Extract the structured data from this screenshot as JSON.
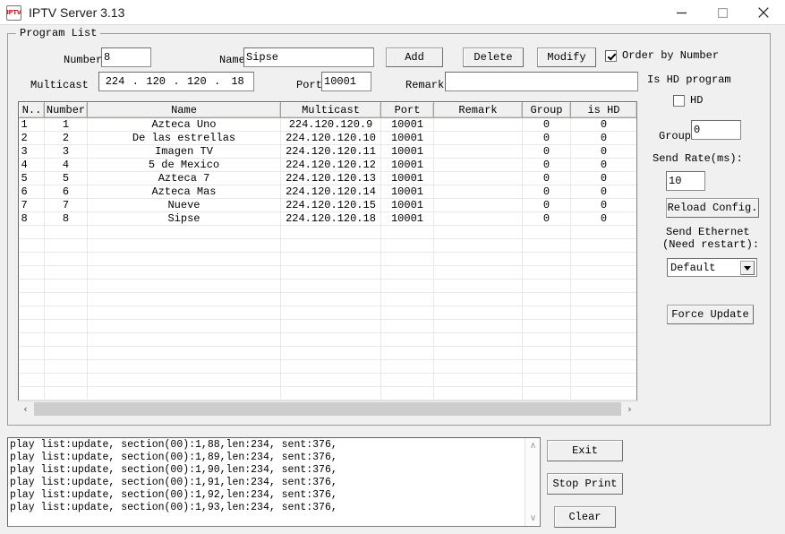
{
  "window": {
    "title": "IPTV Server 3.13",
    "icon": "iptv-app-icon",
    "icon_text": "IPTV",
    "minimize": "—",
    "maximize": "□",
    "close": "✕"
  },
  "group": {
    "title": "Program List"
  },
  "form": {
    "number_label": "Number",
    "number_value": "8",
    "name_label": "Name",
    "name_value": "Sipse",
    "multicast_label": "Multicast",
    "multicast_octets": [
      "224",
      "120",
      "120",
      "18"
    ],
    "multicast_sep": ".",
    "port_label": "Port",
    "port_value": "10001",
    "remark_label": "Remark",
    "remark_value": "",
    "add_label": "Add",
    "delete_label": "Delete",
    "modify_label": "Modify",
    "order_by_number_label": "Order by Number",
    "order_by_number_checked": true
  },
  "side": {
    "is_hd_program_label": "Is HD program",
    "hd_label": "HD",
    "hd_checked": false,
    "group_label": "Group",
    "group_value": "0",
    "send_rate_label": "Send Rate(ms):",
    "send_rate_value": "10",
    "reload_config_label": "Reload Config.",
    "send_ethernet_label_line1": "Send Ethernet",
    "send_ethernet_label_line2": "(Need restart):",
    "ethernet_selected": "Default",
    "ethernet_options": [
      "Default"
    ],
    "force_update_label": "Force Update"
  },
  "table": {
    "columns": [
      "N..",
      "Number",
      "Name",
      "Multicast",
      "Port",
      "Remark",
      "Group",
      "is HD"
    ],
    "rows": [
      [
        "1",
        "1",
        "Azteca Uno",
        "224.120.120.9",
        "10001",
        "",
        "0",
        "0"
      ],
      [
        "2",
        "2",
        "De las estrellas",
        "224.120.120.10",
        "10001",
        "",
        "0",
        "0"
      ],
      [
        "3",
        "3",
        "Imagen TV",
        "224.120.120.11",
        "10001",
        "",
        "0",
        "0"
      ],
      [
        "4",
        "4",
        "5 de Mexico",
        "224.120.120.12",
        "10001",
        "",
        "0",
        "0"
      ],
      [
        "5",
        "5",
        "Azteca 7",
        "224.120.120.13",
        "10001",
        "",
        "0",
        "0"
      ],
      [
        "6",
        "6",
        "Azteca Mas",
        "224.120.120.14",
        "10001",
        "",
        "0",
        "0"
      ],
      [
        "7",
        "7",
        "Nueve",
        "224.120.120.15",
        "10001",
        "",
        "0",
        "0"
      ],
      [
        "8",
        "8",
        "Sipse",
        "224.120.120.18",
        "10001",
        "",
        "0",
        "0"
      ]
    ],
    "empty_row_count": 16,
    "scroll_left_icon": "‹",
    "scroll_right_icon": "›"
  },
  "log": {
    "lines": [
      "play list:update, section(00):1,88,len:234, sent:376,",
      "play list:update, section(00):1,89,len:234, sent:376,",
      "play list:update, section(00):1,90,len:234, sent:376,",
      "play list:update, section(00):1,91,len:234, sent:376,",
      "play list:update, section(00):1,92,len:234, sent:376,",
      "play list:update, section(00):1,93,len:234, sent:376,"
    ],
    "scroll_up_icon": "∧",
    "scroll_down_icon": "∨"
  },
  "actions": {
    "exit_label": "Exit",
    "stop_print_label": "Stop Print",
    "clear_label": "Clear"
  },
  "colors": {
    "window_bg": "#f0f0f0",
    "titlebar_bg": "#ffffff",
    "field_bg": "#ffffff",
    "border": "#9a9a9a",
    "accent_red": "#d2232a"
  }
}
